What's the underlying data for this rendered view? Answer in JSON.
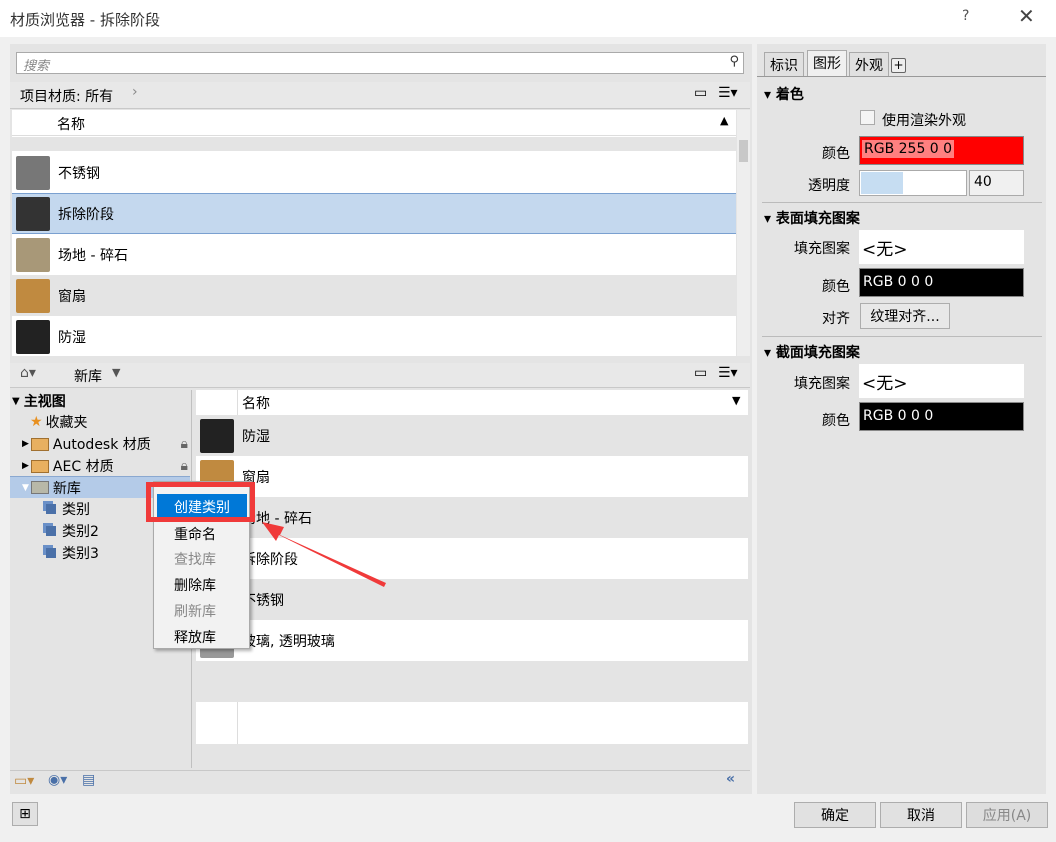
{
  "window": {
    "title": "材质浏览器 - 拆除阶段",
    "help": "?",
    "close": "✕"
  },
  "search": {
    "placeholder": "搜索"
  },
  "project": {
    "header": "项目材质: 所有",
    "column": "名称",
    "rows": [
      {
        "name": "不锈钢",
        "thumb": "#777"
      },
      {
        "name": "拆除阶段",
        "thumb": "#333",
        "selected": true
      },
      {
        "name": "场地 - 碎石",
        "thumb": "#a89878"
      },
      {
        "name": "窗扇",
        "thumb": "#c08a40"
      },
      {
        "name": "防湿",
        "thumb": "#222"
      }
    ]
  },
  "library": {
    "breadcrumb": "新库",
    "column": "名称",
    "tree": {
      "root": "主视图",
      "favorites": "收藏夹",
      "items": [
        {
          "label": "Autodesk 材质",
          "locked": true
        },
        {
          "label": "AEC 材质",
          "locked": true
        },
        {
          "label": "新库",
          "selected": true
        }
      ],
      "categories": [
        "类别",
        "类别2",
        "类别3"
      ]
    },
    "rows": [
      {
        "name": "防湿",
        "thumb": "#222"
      },
      {
        "name": "窗扇",
        "thumb": "#c08a40"
      },
      {
        "name": "场地 - 碎石",
        "thumb": "#a89878"
      },
      {
        "name": "拆除阶段",
        "thumb": "#333"
      },
      {
        "name": "不锈钢",
        "thumb": "#777"
      },
      {
        "name": "玻璃, 透明玻璃",
        "thumb": "#999"
      }
    ]
  },
  "context_menu": {
    "items": [
      {
        "label": "创建类别",
        "highlighted": true
      },
      {
        "label": "重命名"
      },
      {
        "label": "查找库",
        "disabled": true
      },
      {
        "label": "删除库"
      },
      {
        "label": "刷新库",
        "disabled": true
      },
      {
        "label": "释放库"
      }
    ]
  },
  "properties": {
    "tabs": [
      "标识",
      "图形",
      "外观",
      "+"
    ],
    "active_tab": "图形",
    "shading": {
      "title": "着色",
      "use_render": "使用渲染外观",
      "color_label": "颜色",
      "color_value": "RGB 255 0 0",
      "color": "#ff0000",
      "transparency_label": "透明度",
      "transparency": "40"
    },
    "surface": {
      "title": "表面填充图案",
      "pattern_label": "填充图案",
      "pattern": "<无>",
      "color_label": "颜色",
      "color_value": "RGB 0 0 0",
      "align_label": "对齐",
      "align_button": "纹理对齐..."
    },
    "cut": {
      "title": "截面填充图案",
      "pattern_label": "填充图案",
      "pattern": "<无>",
      "color_label": "颜色",
      "color_value": "RGB 0 0 0"
    }
  },
  "footer": {
    "ok": "确定",
    "cancel": "取消",
    "apply": "应用(A)"
  },
  "colors": {
    "highlight": "#0078d7",
    "annotation": "#f03a3a",
    "selection": "#c4d8ee"
  }
}
